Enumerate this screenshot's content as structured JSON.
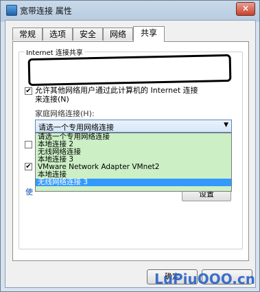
{
  "window": {
    "title": "宽带连接 属性",
    "close_label": "×"
  },
  "tabs": [
    {
      "label": "常规"
    },
    {
      "label": "选项"
    },
    {
      "label": "安全"
    },
    {
      "label": "网络"
    },
    {
      "label": "共享",
      "active": true
    }
  ],
  "sharing": {
    "group_title": "Internet 连接共享",
    "allow_checkbox": {
      "checked": true,
      "text_line1": "允许其他网络用户通过此计算机的 Internet 连接",
      "text_line2": "来连接(N)"
    },
    "home_network_label": "家庭网络连接(H):",
    "dropdown": {
      "selected": "请选一个专用网络连接",
      "options": [
        "请选一个专用网络连接",
        "本地连接 2",
        "无线网络连接",
        "本地连接 3",
        "VMware Network Adapter VMnet2",
        "本地连接",
        "无线网络连接 3"
      ],
      "highlighted_index": 6
    },
    "checkbox2": {
      "checked": false
    },
    "checkbox3": {
      "checked": true
    },
    "link_partial": "使",
    "settings_button_partial": "设置"
  },
  "buttons": {
    "ok": "确定",
    "cancel": ""
  },
  "watermark": "LuPiuOOO.cn",
  "colors": {
    "selection": "#3399ff",
    "dropdown_list_bg": "#ccefc5",
    "annotation": "#000000"
  }
}
